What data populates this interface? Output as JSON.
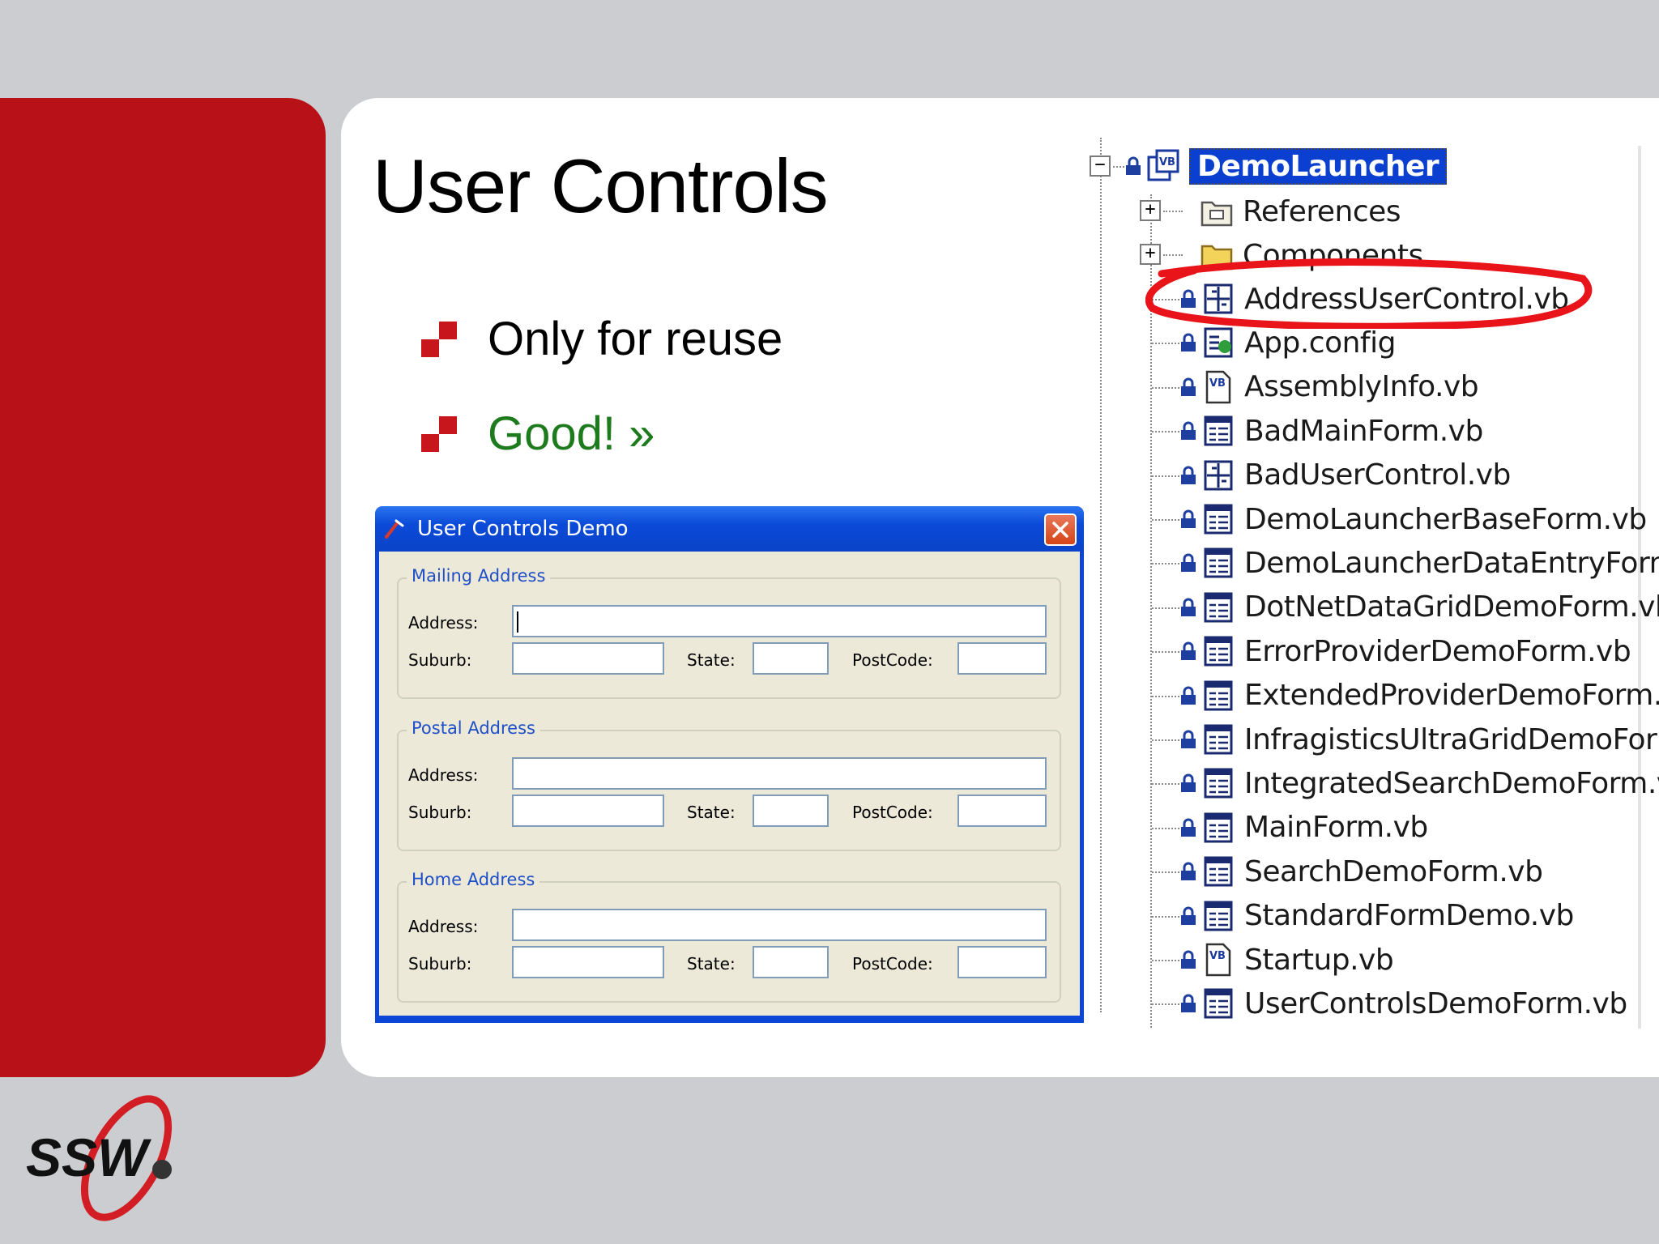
{
  "slide": {
    "title": "User Controls",
    "bullets": [
      {
        "text": "Only for reuse",
        "color": "#000000"
      },
      {
        "text": "Good! »",
        "color": "#1d7a1d"
      }
    ]
  },
  "dialog": {
    "title": "User Controls Demo",
    "groups": [
      {
        "legend": "Mailing Address",
        "address_label": "Address:",
        "suburb_label": "Suburb:",
        "state_label": "State:",
        "postcode_label": "PostCode:"
      },
      {
        "legend": "Postal Address",
        "address_label": "Address:",
        "suburb_label": "Suburb:",
        "state_label": "State:",
        "postcode_label": "PostCode:"
      },
      {
        "legend": "Home Address",
        "address_label": "Address:",
        "suburb_label": "Suburb:",
        "state_label": "State:",
        "postcode_label": "PostCode:"
      }
    ]
  },
  "tree": {
    "root": "DemoLauncher",
    "folders": [
      "References",
      "Components"
    ],
    "files": [
      {
        "name": "AddressUserControl.vb",
        "icon": "user-control-icon"
      },
      {
        "name": "App.config",
        "icon": "config-icon"
      },
      {
        "name": "AssemblyInfo.vb",
        "icon": "vb-file-icon"
      },
      {
        "name": "BadMainForm.vb",
        "icon": "form-icon"
      },
      {
        "name": "BadUserControl.vb",
        "icon": "user-control-icon"
      },
      {
        "name": "DemoLauncherBaseForm.vb",
        "icon": "form-icon"
      },
      {
        "name": "DemoLauncherDataEntryForm.vb",
        "icon": "form-icon"
      },
      {
        "name": "DotNetDataGridDemoForm.vb",
        "icon": "form-icon"
      },
      {
        "name": "ErrorProviderDemoForm.vb",
        "icon": "form-icon"
      },
      {
        "name": "ExtendedProviderDemoForm.vb",
        "icon": "form-icon"
      },
      {
        "name": "InfragisticsUltraGridDemoForm.vb",
        "icon": "form-icon"
      },
      {
        "name": "IntegratedSearchDemoForm.vb",
        "icon": "form-icon"
      },
      {
        "name": "MainForm.vb",
        "icon": "form-icon"
      },
      {
        "name": "SearchDemoForm.vb",
        "icon": "form-icon"
      },
      {
        "name": "StandardFormDemo.vb",
        "icon": "form-icon"
      },
      {
        "name": "Startup.vb",
        "icon": "vb-file-icon"
      },
      {
        "name": "UserControlsDemoForm.vb",
        "icon": "form-icon"
      }
    ],
    "highlighted": "AddressUserControl.vb"
  },
  "logo": {
    "text": "SSW"
  },
  "colors": {
    "red_panel": "#b81117",
    "bullet_mark": "#c8161d",
    "annotation": "#e8141a",
    "selection": "#0a3fd0"
  }
}
